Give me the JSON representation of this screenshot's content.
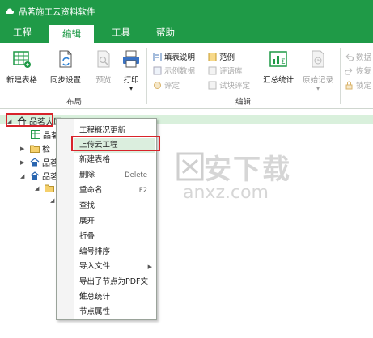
{
  "window": {
    "title": "品茗施工云资料软件"
  },
  "menu": {
    "tabs": [
      "工程",
      "编辑",
      "工具",
      "帮助"
    ],
    "active_index": 1
  },
  "ribbon": {
    "layout_group": {
      "label": "布局",
      "buttons": [
        "新建表格",
        "同步设置",
        "预览",
        "打印"
      ]
    },
    "edit_group": {
      "label": "编辑",
      "small_items": [
        "填表说明",
        "示例数据",
        "评定",
        "范例",
        "评语库",
        "试块评定"
      ],
      "buttons": [
        "汇总统计",
        "原始记录"
      ]
    },
    "right_items": [
      "数据",
      "恢复",
      "锁定"
    ]
  },
  "tree": {
    "root": "品茗大厦",
    "nodes": [
      "品茗",
      "检",
      "品茗",
      "品茗"
    ]
  },
  "context_menu": {
    "items": [
      {
        "label": "工程概况更新",
        "shortcut": ""
      },
      {
        "label": "上传云工程",
        "shortcut": ""
      },
      {
        "label": "新建表格",
        "shortcut": ""
      },
      {
        "label": "删除",
        "shortcut": "Delete"
      },
      {
        "label": "重命名",
        "shortcut": "F2"
      },
      {
        "label": "查找",
        "shortcut": ""
      },
      {
        "label": "展开",
        "shortcut": ""
      },
      {
        "label": "折叠",
        "shortcut": ""
      },
      {
        "label": "编号排序",
        "shortcut": ""
      },
      {
        "label": "导入文件",
        "shortcut": ""
      },
      {
        "label": "导出子节点为PDF文件",
        "shortcut": ""
      },
      {
        "label": "汇总统计",
        "shortcut": ""
      },
      {
        "label": "节点属性",
        "shortcut": ""
      }
    ],
    "highlighted_index": 1
  },
  "watermark": {
    "text": "安下载",
    "domain": "anxz.com"
  },
  "colors": {
    "brand_green": "#1f9a47",
    "highlight": "#d8232a",
    "selection_bg": "#dbeede"
  }
}
